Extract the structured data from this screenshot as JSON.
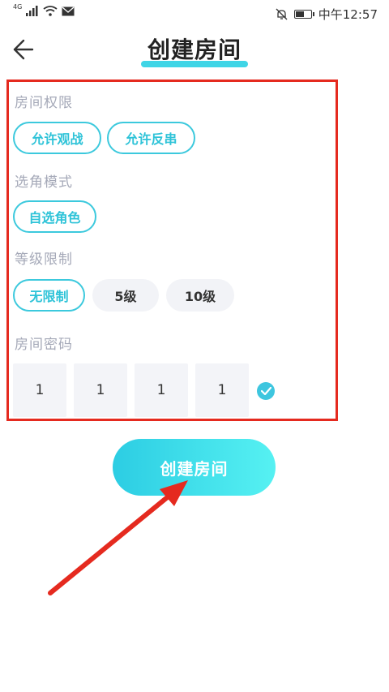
{
  "status_bar": {
    "network": "4G",
    "time": "中午12:57"
  },
  "header": {
    "title": "创建房间"
  },
  "room_permission": {
    "label": "房间权限",
    "options": [
      {
        "label": "允许观战",
        "selected": true
      },
      {
        "label": "允许反串",
        "selected": true
      }
    ]
  },
  "role_mode": {
    "label": "选角模式",
    "options": [
      {
        "label": "自选角色",
        "selected": true
      }
    ]
  },
  "level_limit": {
    "label": "等级限制",
    "options": [
      {
        "label": "无限制",
        "selected": true
      },
      {
        "label": "5级",
        "selected": false
      },
      {
        "label": "10级",
        "selected": false
      }
    ]
  },
  "password": {
    "label": "房间密码",
    "digits": [
      "1",
      "1",
      "1",
      "1"
    ]
  },
  "create_button": {
    "label": "创建房间"
  },
  "colors": {
    "accent": "#3cc9dd",
    "annotation": "#e52a1f",
    "label_gray": "#a5a9b8"
  }
}
